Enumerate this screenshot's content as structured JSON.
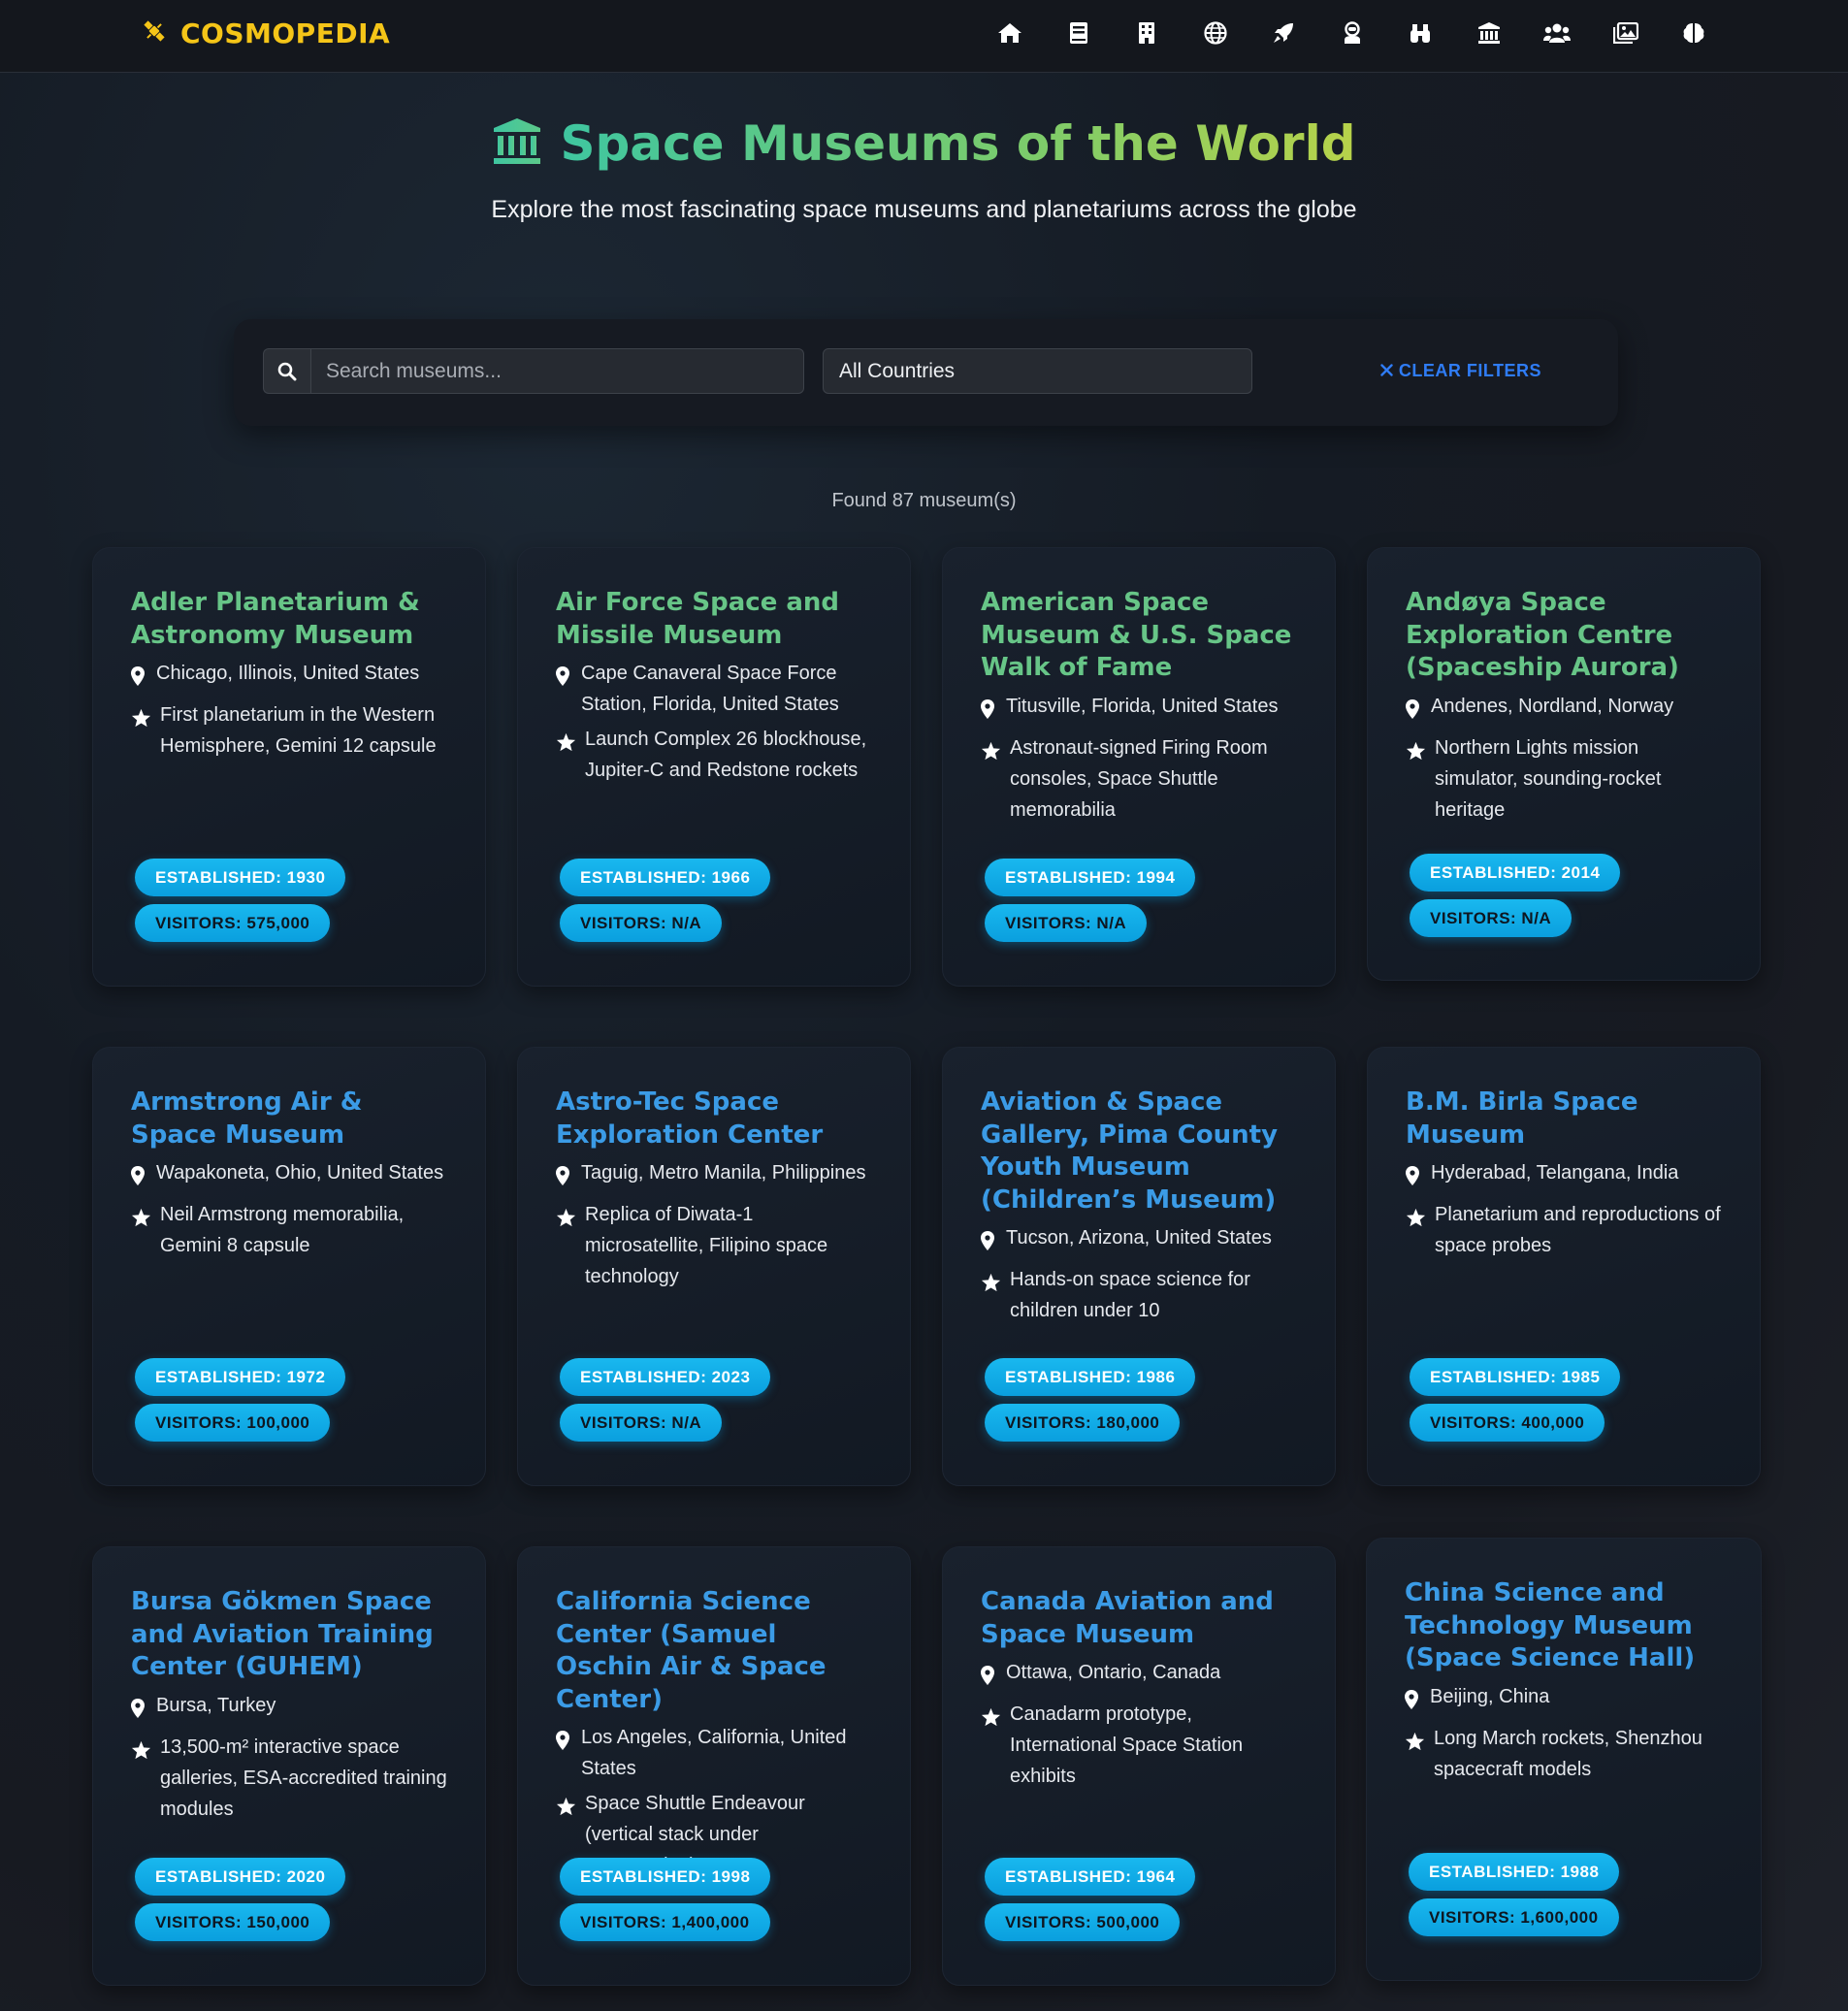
{
  "brand": {
    "name": "COSMOPEDIA"
  },
  "nav": {
    "icons": [
      "home-icon",
      "book-icon",
      "building-icon",
      "globe-icon",
      "rocket-icon",
      "astronaut-icon",
      "binoculars-icon",
      "museum-icon",
      "users-icon",
      "images-icon",
      "brain-icon"
    ]
  },
  "hero": {
    "title": "Space Museums of the World",
    "subtitle": "Explore the most fascinating space museums and planetariums across the globe"
  },
  "filters": {
    "search_placeholder": "Search museums...",
    "country_selected": "All Countries",
    "clear_label": "CLEAR FILTERS"
  },
  "results": {
    "found_text": "Found 87 museum(s)"
  },
  "museums": [
    {
      "name": "Adler Planetarium & Astronomy Museum",
      "location": "Chicago, Illinois, United States",
      "highlight": "First planetarium in the Western Hemisphere, Gemini 12 capsule",
      "established": "ESTABLISHED: 1930",
      "visitors": "VISITORS: 575,000"
    },
    {
      "name": "Air Force Space and Missile Museum",
      "location": "Cape Canaveral Space Force Station, Florida, United States",
      "highlight": "Launch Complex 26 blockhouse, Jupiter-C and Redstone rockets",
      "established": "ESTABLISHED: 1966",
      "visitors": "VISITORS: N/A"
    },
    {
      "name": "American Space Museum & U.S. Space Walk of Fame",
      "location": "Titusville, Florida, United States",
      "highlight": "Astronaut-signed Firing Room consoles, Space Shuttle memorabilia",
      "established": "ESTABLISHED: 1994",
      "visitors": "VISITORS: N/A"
    },
    {
      "name": "Andøya Space Exploration Centre (Spaceship Aurora)",
      "location": "Andenes, Nordland, Norway",
      "highlight": "Northern Lights mission simulator, sounding-rocket heritage",
      "established": "ESTABLISHED: 2014",
      "visitors": "VISITORS: N/A"
    },
    {
      "name": "Armstrong Air & Space Museum",
      "location": "Wapakoneta, Ohio, United States",
      "highlight": "Neil Armstrong memorabilia, Gemini 8 capsule",
      "established": "ESTABLISHED: 1972",
      "visitors": "VISITORS: 100,000"
    },
    {
      "name": "Astro-Tec Space Exploration Center",
      "location": "Taguig, Metro Manila, Philippines",
      "highlight": "Replica of Diwata-1 microsatellite, Filipino space technology",
      "established": "ESTABLISHED: 2023",
      "visitors": "VISITORS: N/A"
    },
    {
      "name": "Aviation & Space Gallery, Pima County Youth Museum (Children’s Museum)",
      "location": "Tucson, Arizona, United States",
      "highlight": "Hands-on space science for children under 10",
      "established": "ESTABLISHED: 1986",
      "visitors": "VISITORS: 180,000"
    },
    {
      "name": "B.M. Birla Space Museum",
      "location": "Hyderabad, Telangana, India",
      "highlight": "Planetarium and reproductions of space probes",
      "established": "ESTABLISHED: 1985",
      "visitors": "VISITORS: 400,000"
    },
    {
      "name": "Bursa Gökmen Space and Aviation Training Center (GUHEM)",
      "location": "Bursa, Turkey",
      "highlight": "13,500-m² interactive space galleries, ESA-accredited training modules",
      "established": "ESTABLISHED: 2020",
      "visitors": "VISITORS: 150,000"
    },
    {
      "name": "California Science Center (Samuel Oschin Air & Space Center)",
      "location": "Los Angeles, California, United States",
      "highlight": "Space Shuttle Endeavour (vertical stack under construction)",
      "established": "ESTABLISHED: 1998",
      "visitors": "VISITORS: 1,400,000"
    },
    {
      "name": "Canada Aviation and Space Museum",
      "location": "Ottawa, Ontario, Canada",
      "highlight": "Canadarm prototype, International Space Station exhibits",
      "established": "ESTABLISHED: 1964",
      "visitors": "VISITORS: 500,000"
    },
    {
      "name": "China Science and Technology Museum (Space Science Hall)",
      "location": "Beijing, China",
      "highlight": "Long March rockets, Shenzhou spacecraft models",
      "established": "ESTABLISHED: 1988",
      "visitors": "VISITORS: 1,600,000"
    }
  ],
  "colors": {
    "brand": "#f5c518",
    "link": "#3b9be6",
    "accent_green": "#67c587",
    "badge": "#19b8ef",
    "clear": "#2f7cf6"
  }
}
